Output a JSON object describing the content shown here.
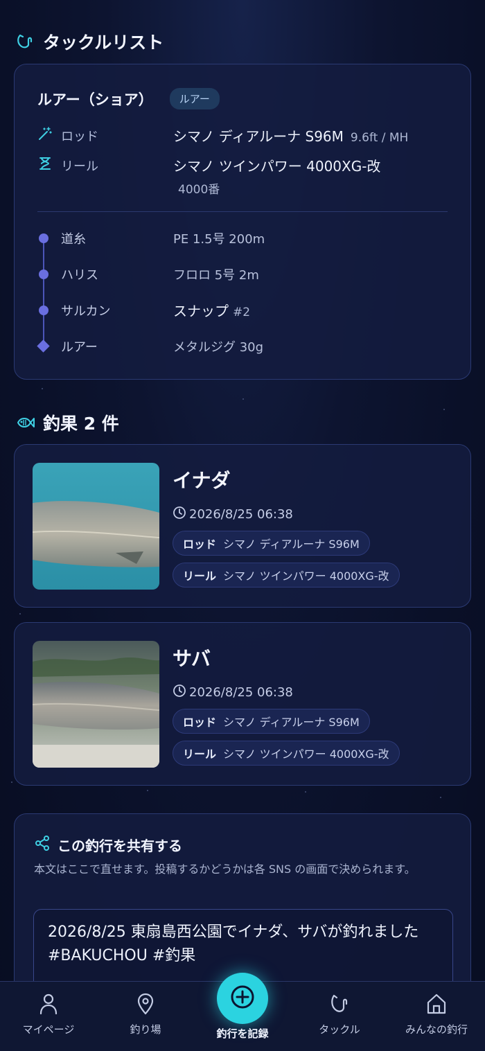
{
  "tackle_section": {
    "title": "タックルリスト",
    "card": {
      "name": "ルアー（ショア）",
      "badge": "ルアー",
      "rod": {
        "label": "ロッド",
        "value": "シマノ ディアルーナ S96M",
        "sub": "9.6ft / MH"
      },
      "reel": {
        "label": "リール",
        "value": "シマノ ツインパワー 4000XG-改",
        "sub": "4000番"
      },
      "line_items": [
        {
          "label": "道糸",
          "value": "PE 1.5号 200m"
        },
        {
          "label": "ハリス",
          "value": "フロロ 5号 2m"
        },
        {
          "label": "サルカン",
          "value": "スナップ",
          "sub": "#2"
        },
        {
          "label": "ルアー",
          "value": "メタルジグ 30g"
        }
      ]
    }
  },
  "catch_section": {
    "title": "釣果 2 件",
    "catches": [
      {
        "name": "イナダ",
        "time": "2026/8/25 06:38",
        "rod_label": "ロッド",
        "rod_value": "シマノ ディアルーナ S96M",
        "reel_label": "リール",
        "reel_value": "シマノ ツインパワー 4000XG-改"
      },
      {
        "name": "サバ",
        "time": "2026/8/25 06:38",
        "rod_label": "ロッド",
        "rod_value": "シマノ ディアルーナ S96M",
        "reel_label": "リール",
        "reel_value": "シマノ ツインパワー 4000XG-改"
      }
    ]
  },
  "share": {
    "title": "この釣行を共有する",
    "description": "本文はここで直せます。投稿するかどうかは各 SNS の画面で決められます。",
    "text": "2026/8/25 東扇島西公園でイナダ、サバが釣れました\n#BAKUCHOU #釣果"
  },
  "nav": {
    "items": [
      {
        "label": "マイページ",
        "icon": "person-icon"
      },
      {
        "label": "釣り場",
        "icon": "map-pin-icon"
      },
      {
        "label": "釣行を記録",
        "icon": "plus-circle-icon"
      },
      {
        "label": "タックル",
        "icon": "fishing-hook-icon"
      },
      {
        "label": "みんなの釣行",
        "icon": "home-icon"
      }
    ]
  },
  "colors": {
    "accent": "#2bd3e0",
    "line_marker": "#6a6fe0",
    "card_bg": "#141c40",
    "background": "#0a1028"
  }
}
